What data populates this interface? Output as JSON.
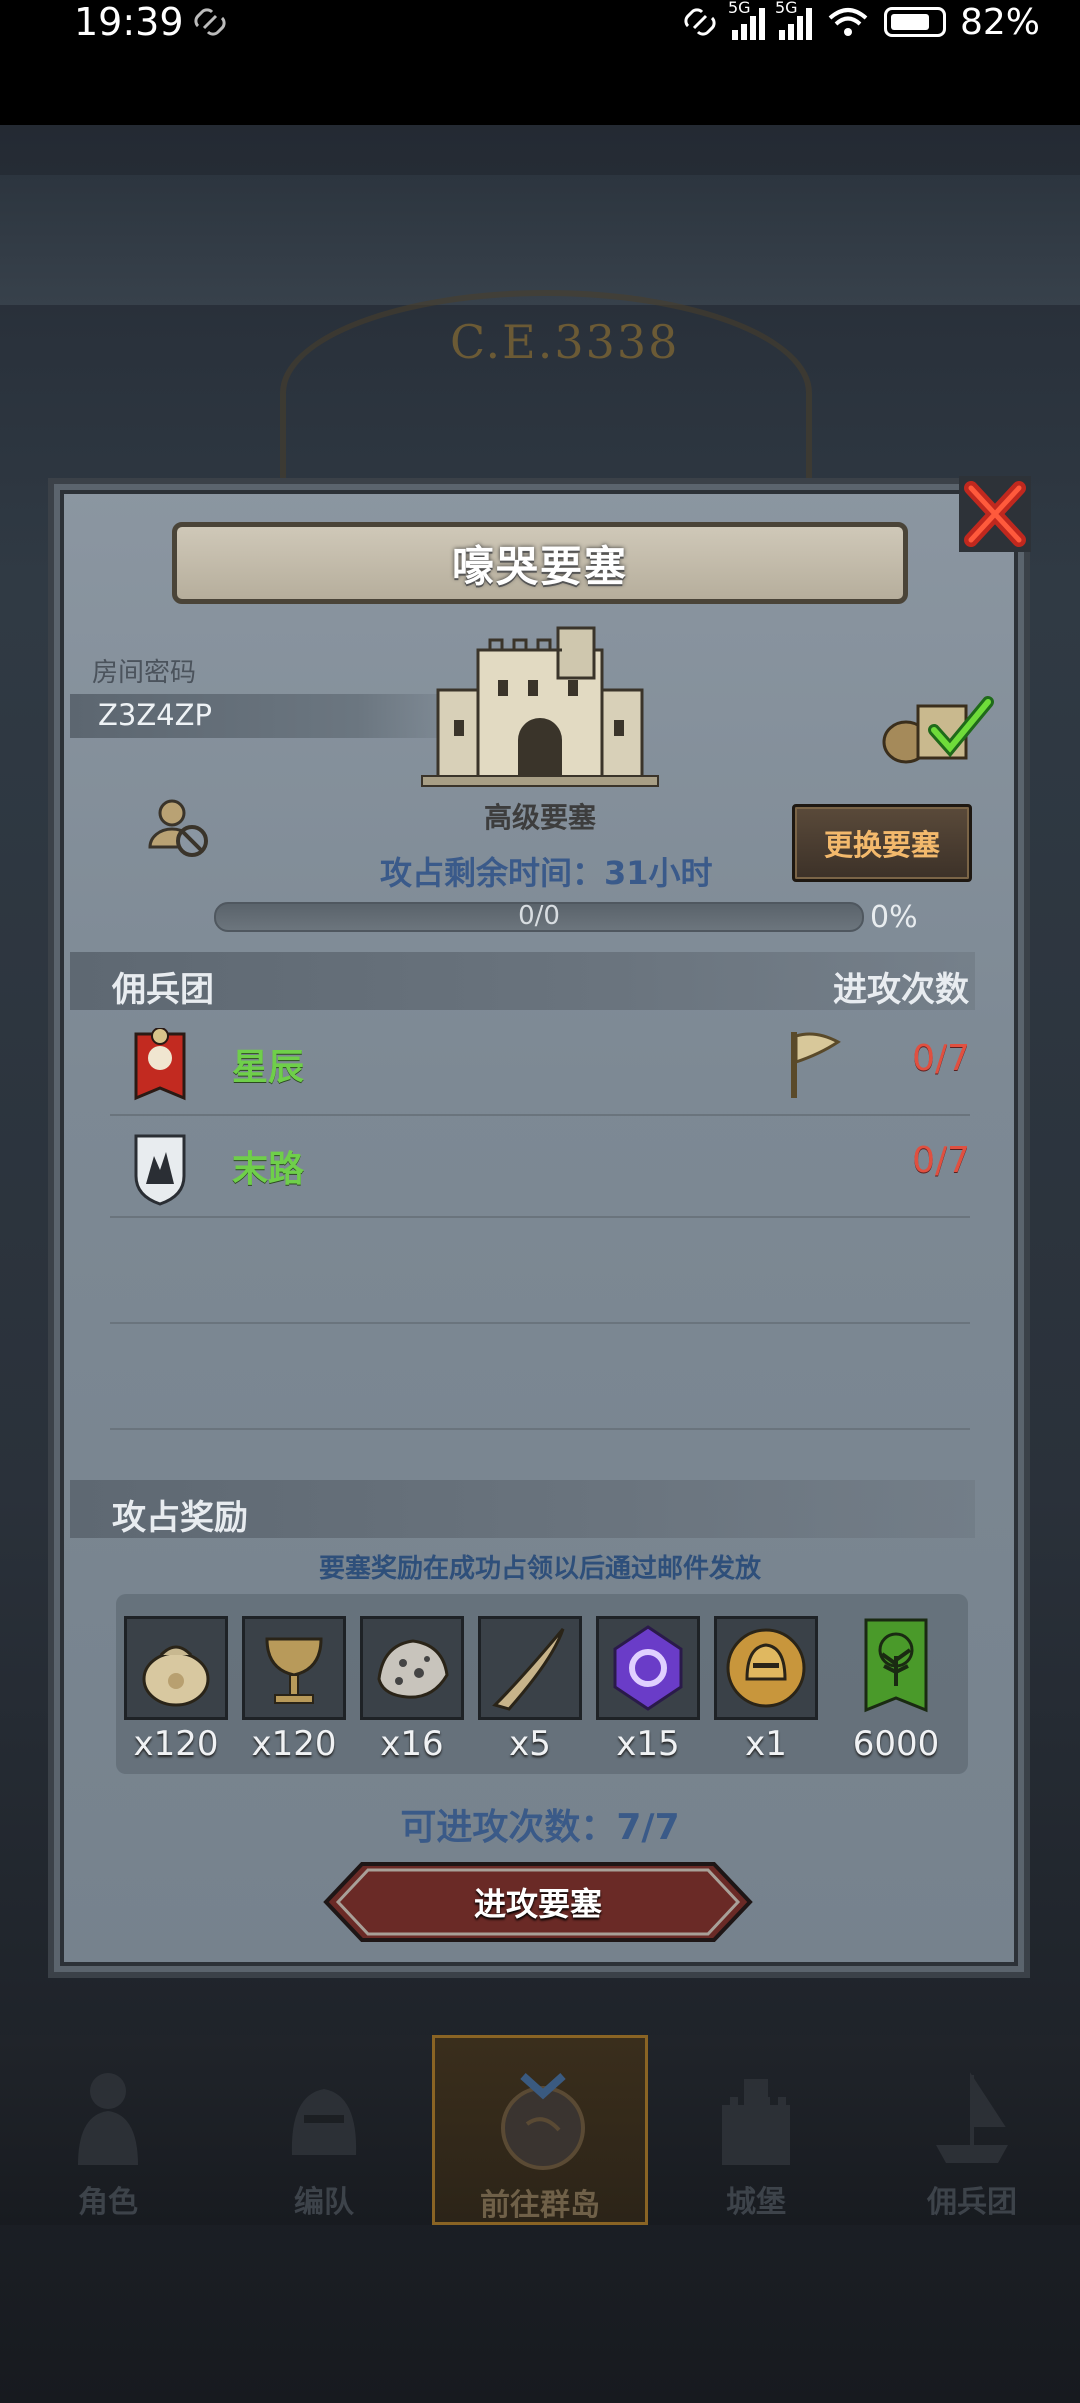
{
  "status_bar": {
    "time": "19:39",
    "network1": "5G",
    "network2": "5G",
    "battery": "82%"
  },
  "background": {
    "ce_text": "C.E.3338"
  },
  "dialog": {
    "title": "嚎哭要塞",
    "room_label": "房间密码",
    "room_code": "Z3Z4ZP",
    "fortress_level": "高级要塞",
    "change_button": "更换要塞",
    "time_remaining": "攻占剩余时间：31小时",
    "progress_text": "0/0",
    "progress_percent": "0%",
    "mercenary_header": "佣兵团",
    "attacks_header": "进攻次数",
    "mercenaries": [
      {
        "name": "星辰",
        "attacks": "0/7"
      },
      {
        "name": "末路",
        "attacks": "0/7"
      }
    ],
    "reward_header": "攻占奖励",
    "reward_note": "要塞奖励在成功占领以后通过邮件发放",
    "rewards": [
      {
        "icon": "coin-sack-icon",
        "qty": "x120"
      },
      {
        "icon": "chalice-icon",
        "qty": "x120"
      },
      {
        "icon": "ore-icon",
        "qty": "x16"
      },
      {
        "icon": "horn-icon",
        "qty": "x5"
      },
      {
        "icon": "purple-crystal-icon",
        "qty": "x15"
      },
      {
        "icon": "knight-helmet-icon",
        "qty": "x1"
      },
      {
        "icon": "tree-banner-icon",
        "qty": "6000"
      }
    ],
    "attempts": "可进攻次数：7/7",
    "attack_button": "进攻要塞"
  },
  "bottom_nav": [
    {
      "label": "角色"
    },
    {
      "label": "编队"
    },
    {
      "label": "前往群岛",
      "active": true
    },
    {
      "label": "城堡"
    },
    {
      "label": "佣兵团"
    }
  ]
}
